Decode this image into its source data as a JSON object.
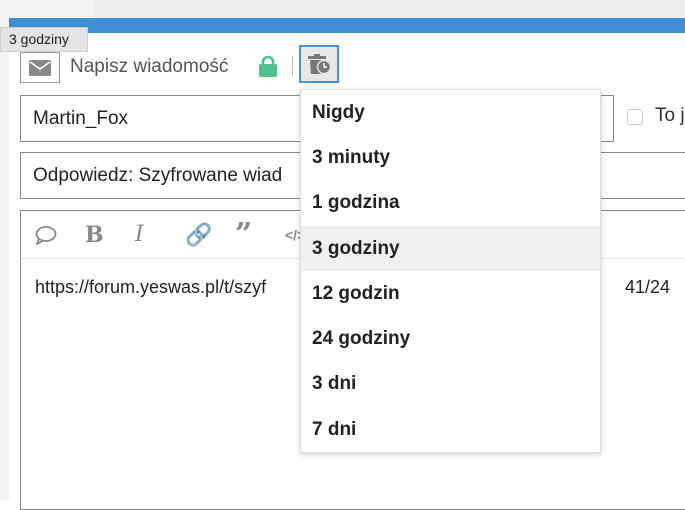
{
  "tooltip": "3 godziny",
  "header": {
    "title": "Napisz wiadomość",
    "icons": [
      "envelope-icon",
      "lock-icon",
      "timer-trash-icon"
    ],
    "lock_color": "#4fc28b",
    "accent": "#3d8fd6"
  },
  "form": {
    "recipient": "Martin_Fox",
    "checkbox_label": "To j",
    "subject": "Odpowiedz: Szyfrowane wiad"
  },
  "editor": {
    "toolbar": [
      "quote-bubble-icon",
      "bold-icon",
      "italic-icon",
      "link-icon",
      "blockquote-icon",
      "code-icon"
    ],
    "content_start": "https://forum.yeswas.pl/t/szyf",
    "content_end": "41/24"
  },
  "dropdown": {
    "selected": "3 godziny",
    "options": [
      "Nigdy",
      "3 minuty",
      "1 godzina",
      "3 godziny",
      "12 godzin",
      "24 godziny",
      "3 dni",
      "7 dni"
    ]
  }
}
